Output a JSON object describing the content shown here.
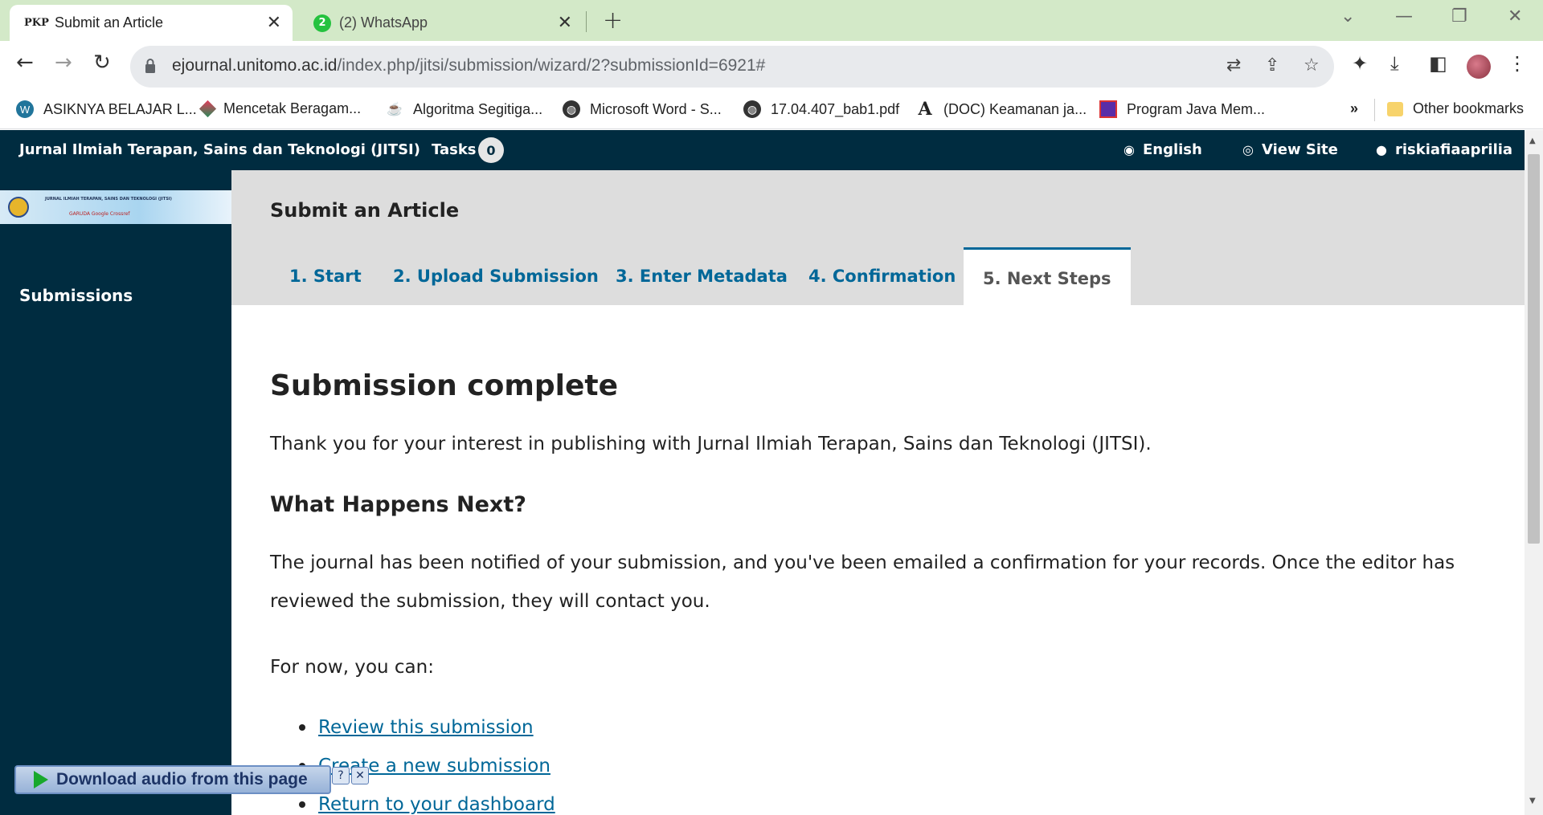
{
  "browser": {
    "tabs": [
      {
        "favicon": "PKP",
        "title": "Submit an Article",
        "active": true
      },
      {
        "favicon": "2",
        "title": "(2) WhatsApp",
        "active": false
      }
    ],
    "url_host": "ejournal.unitomo.ac.id",
    "url_path": "/index.php/jitsi/submission/wizard/2?submissionId=6921#",
    "bookmarks": [
      {
        "icon": "wordpress-icon",
        "label": "ASIKNYA BELAJAR L..."
      },
      {
        "icon": "app-icon",
        "label": "Mencetak Beragam..."
      },
      {
        "icon": "coffee-icon",
        "label": "Algoritma Segitiga..."
      },
      {
        "icon": "globe-icon",
        "label": "Microsoft Word - S..."
      },
      {
        "icon": "globe-icon",
        "label": "17.04.407_bab1.pdf"
      },
      {
        "icon": "academia-icon",
        "label": "(DOC) Keamanan ja..."
      },
      {
        "icon": "app-icon",
        "label": "Program Java Mem..."
      }
    ],
    "bookmarks_overflow": "»",
    "other_bookmarks": "Other bookmarks"
  },
  "header": {
    "journal_title": "Jurnal Ilmiah Terapan, Sains dan Teknologi (JITSI)",
    "tasks_label": "Tasks",
    "tasks_count": "0",
    "language": "English",
    "view_site": "View Site",
    "username": "riskiafiaaprilia"
  },
  "sidebar": {
    "logo_text": "JURNAL ILMIAH TERAPAN, SAINS DAN TEKNOLOGI (JITSI)",
    "logo_sub": "GARUDA  Google  Crossref",
    "submissions_label": "Submissions"
  },
  "page": {
    "title": "Submit an Article",
    "wizard_tabs": [
      "1. Start",
      "2. Upload Submission",
      "3. Enter Metadata",
      "4. Confirmation",
      "5. Next Steps"
    ],
    "current_tab": 4
  },
  "content": {
    "heading": "Submission complete",
    "thanks": "Thank you for your interest in publishing with Jurnal Ilmiah Terapan, Sains dan Teknologi (JITSI).",
    "subheading": "What Happens Next?",
    "notified": "The journal has been notified of your submission, and you've been emailed a confirmation for your records. Once the editor has reviewed the submission, they will contact you.",
    "for_now": "For now, you can:",
    "links": [
      "Review this submission",
      "Create a new submission",
      "Return to your dashboard"
    ]
  },
  "overlay": {
    "audio_label": "Download audio from this page",
    "help": "?",
    "close": "✕"
  },
  "colors": {
    "header_bg": "#002c40",
    "link": "#006798",
    "tab_strip": "#d3e9c8"
  }
}
